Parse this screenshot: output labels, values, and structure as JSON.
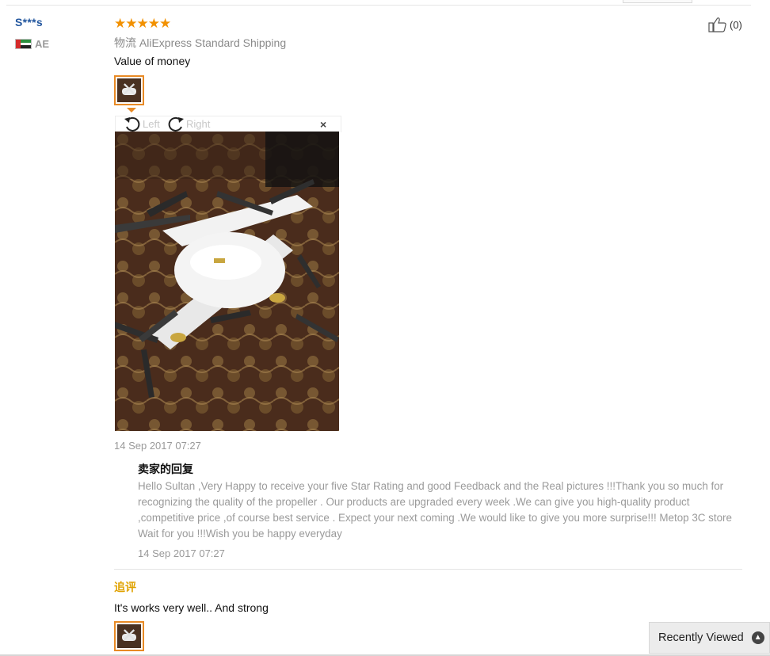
{
  "review": {
    "user_name": "S***s",
    "country": "AE",
    "rating": 5,
    "stars": "★★★★★",
    "shipping_label": "物流",
    "shipping_method": "AliExpress Standard Shipping",
    "text": "Value of money",
    "helpful_count": "(0)",
    "date": "14 Sep 2017 07:27"
  },
  "viewer": {
    "rotate_left_label": "Left",
    "rotate_right_label": "Right",
    "close_glyph": "×"
  },
  "seller_reply": {
    "title": "卖家的回复",
    "text": "Hello Sultan ,Very Happy to receive your five Star Rating and good Feedback and the Real pictures !!!Thank you so much for recognizing the quality of the propeller . Our products are upgraded every week .We can give you high-quality product ,competitive price ,of course best service . Expect your next coming .We would like to give you more surprise!!! Metop 3C store Wait for you !!!Wish you be happy everyday",
    "date": "14 Sep 2017 07:27"
  },
  "followup": {
    "label": "追评",
    "text": "It's works very well.. And strong"
  },
  "recently_viewed": {
    "label": "Recently Viewed"
  },
  "colors": {
    "star": "#f29100",
    "user_name": "#22569e",
    "followup_label": "#e0a200",
    "thumb_border": "#e88a25"
  }
}
